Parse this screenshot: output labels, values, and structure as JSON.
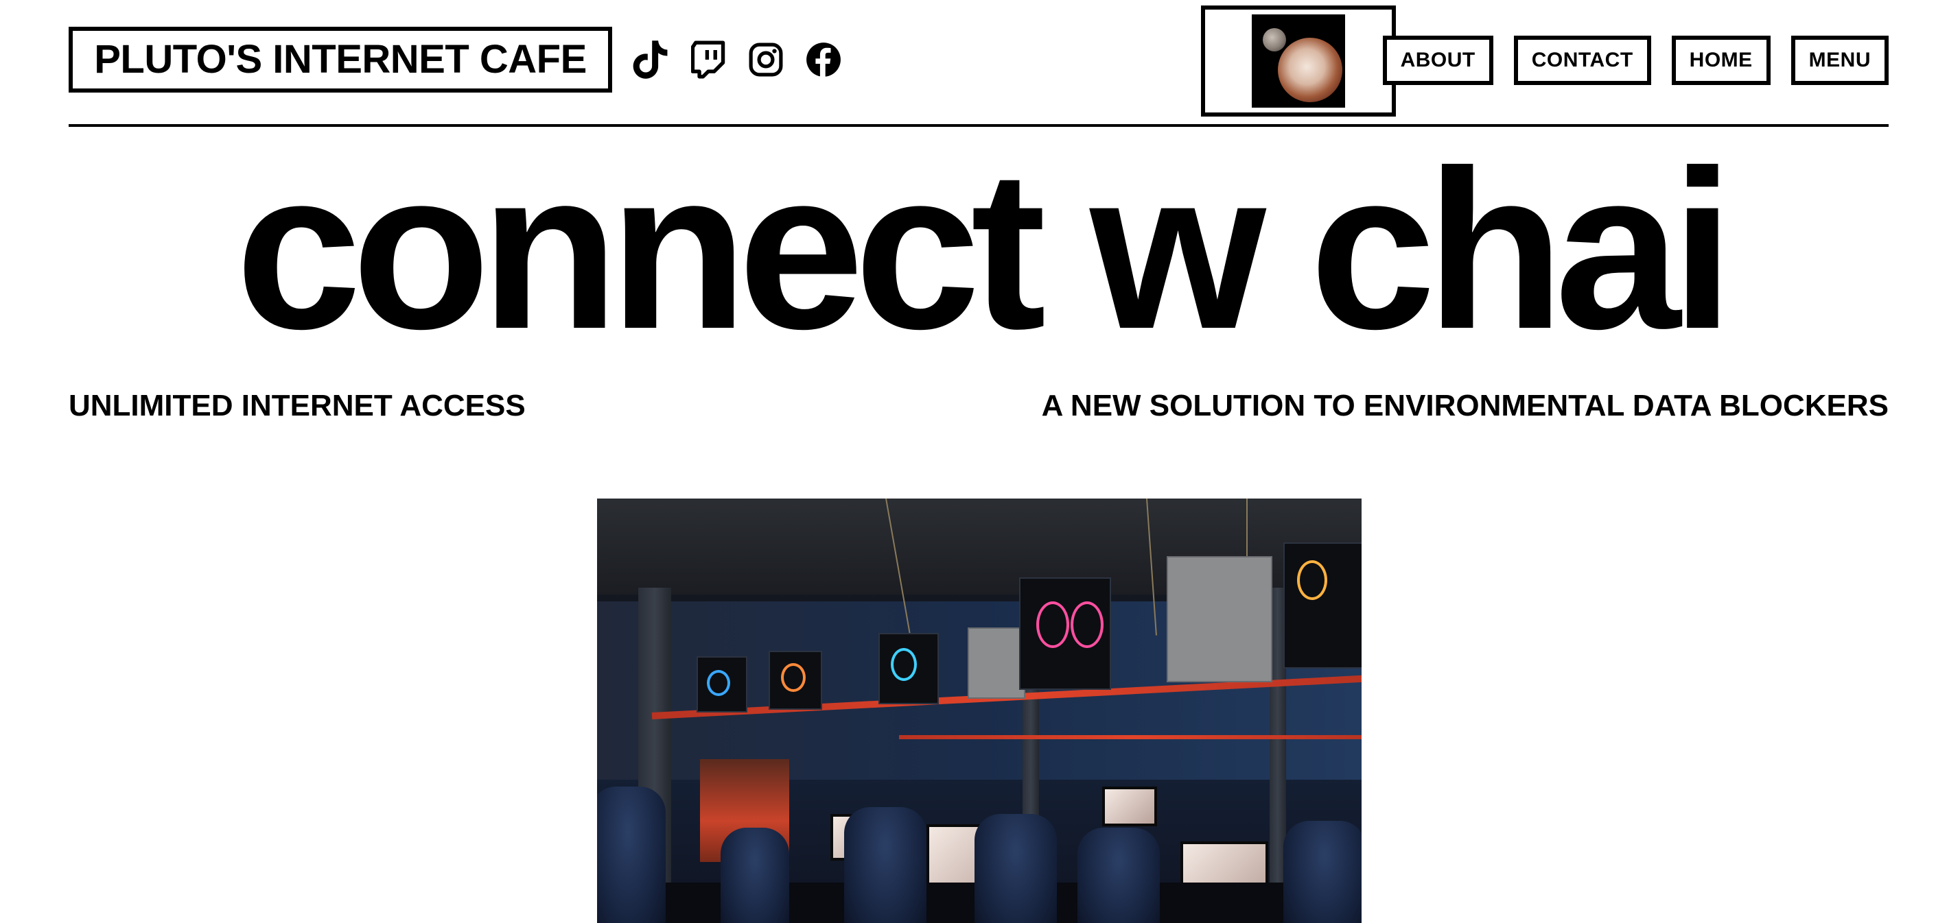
{
  "header": {
    "brand": "PLUTO'S INTERNET CAFE",
    "social": [
      {
        "name": "tiktok-icon"
      },
      {
        "name": "twitch-icon"
      },
      {
        "name": "instagram-icon"
      },
      {
        "name": "facebook-icon"
      }
    ],
    "logo_icon": "pluto-planet-image",
    "nav": {
      "about": "ABOUT",
      "contact": "CONTACT",
      "home": "HOME",
      "menu": "MENU"
    }
  },
  "hero": {
    "title": "connect w chai",
    "tagline_left": "UNLIMITED INTERNET ACCESS",
    "tagline_right": "A NEW SOLUTION TO ENVIRONMENTAL DATA BLOCKERS"
  },
  "photo": {
    "subject": "gaming-cafe-photo"
  },
  "colors": {
    "text": "#000000",
    "background": "#ffffff",
    "border": "#000000"
  }
}
